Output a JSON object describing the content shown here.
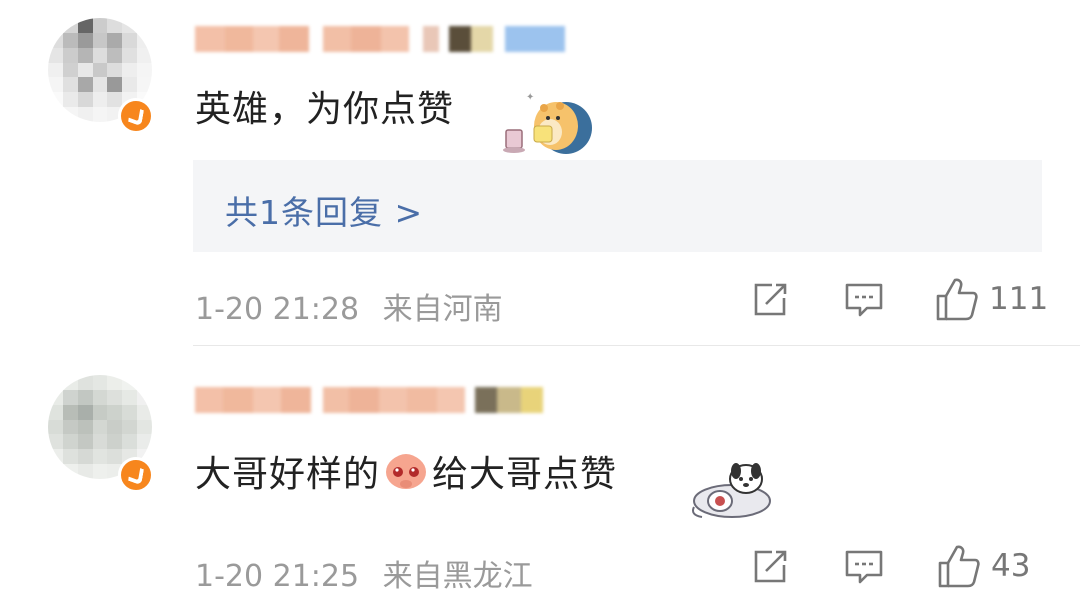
{
  "comments": [
    {
      "text": "英雄，为你点赞",
      "replies_label": "共1条回复 >",
      "timestamp": "1-20 21:28",
      "location": "来自河南",
      "like_count": "111",
      "sticker_icon": "hamster-sticker-icon"
    },
    {
      "text_part1": "大哥好样的",
      "text_part2": "给大哥点赞",
      "timestamp": "1-20 21:25",
      "location": "来自黑龙江",
      "like_count": "43",
      "emoji_icon": "shy-face-emoji-icon",
      "sticker_icon": "dog-sticker-icon"
    }
  ],
  "colors": {
    "text": "#222222",
    "meta": "#9a9a9a",
    "link": "#4a6ea8",
    "reply_bg": "#f4f5f7",
    "verified_badge": "#f7861d"
  }
}
